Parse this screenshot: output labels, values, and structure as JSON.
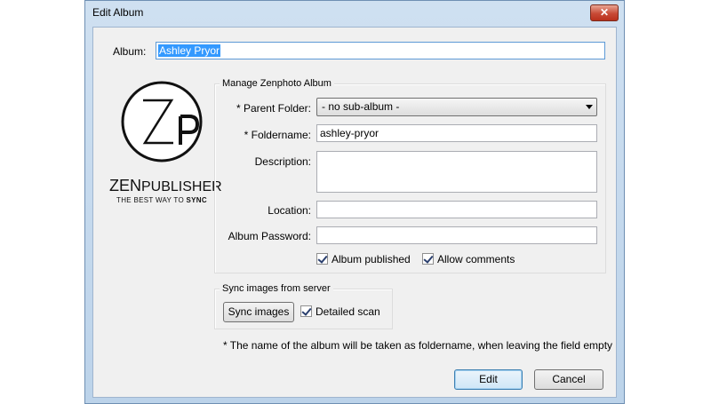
{
  "window": {
    "title": "Edit Album",
    "close_glyph": "✕"
  },
  "album": {
    "label": "Album:",
    "value": "Ashley Pryor"
  },
  "logo": {
    "icon": "zenpublisher-logo",
    "wordmark_bold": "ZEN",
    "wordmark_rest": "PUBLISHER",
    "tagline_pre": "THE BEST WAY TO ",
    "tagline_bold": "SYNC"
  },
  "manage_group": {
    "title": "Manage Zenphoto Album",
    "parent_folder_label": "* Parent Folder:",
    "parent_folder_value": "- no sub-album -",
    "foldername_label": "* Foldername:",
    "foldername_value": "ashley-pryor",
    "description_label": "Description:",
    "description_value": "",
    "location_label": "Location:",
    "location_value": "",
    "password_label": "Album Password:",
    "password_value": "",
    "album_published_label": "Album published",
    "album_published_checked": true,
    "allow_comments_label": "Allow comments",
    "allow_comments_checked": true
  },
  "sync_group": {
    "title": "Sync images from server",
    "sync_button_label": "Sync images",
    "detailed_scan_label": "Detailed scan",
    "detailed_scan_checked": true
  },
  "note": "*  The name of the album will be taken as foldername, when leaving the field empty",
  "buttons": {
    "edit_label": "Edit",
    "cancel_label": "Cancel"
  }
}
